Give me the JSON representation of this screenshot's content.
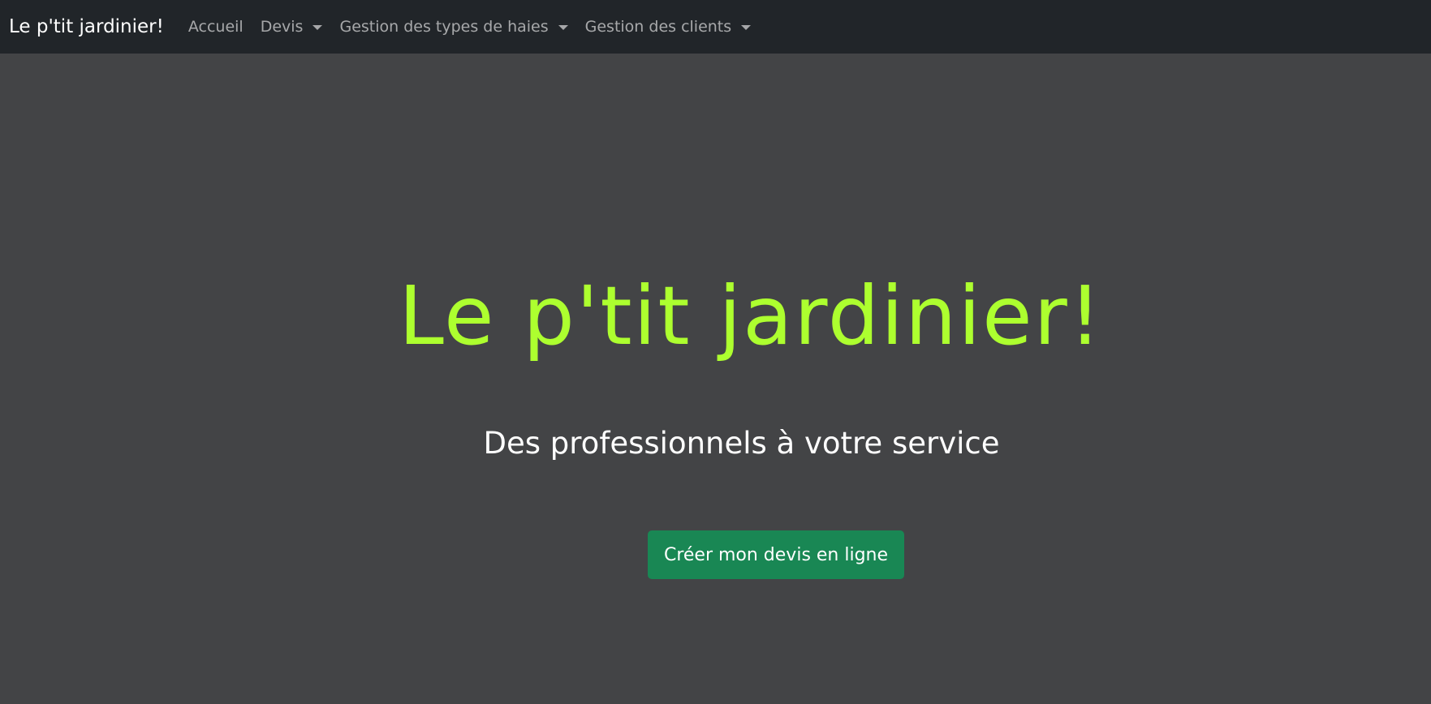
{
  "navbar": {
    "brand": "Le p'tit jardinier!",
    "items": [
      {
        "label": "Accueil",
        "dropdown": false
      },
      {
        "label": "Devis",
        "dropdown": true
      },
      {
        "label": "Gestion des types de haies",
        "dropdown": true
      },
      {
        "label": "Gestion des clients",
        "dropdown": true
      }
    ]
  },
  "hero": {
    "title": "Le p'tit jardinier!",
    "subtitle": "Des professionnels à votre service",
    "cta_label": "Créer mon devis en ligne"
  },
  "colors": {
    "navbar_bg": "#212529",
    "page_bg": "#434446",
    "title_color": "#adff2f",
    "cta_bg": "#198754"
  }
}
